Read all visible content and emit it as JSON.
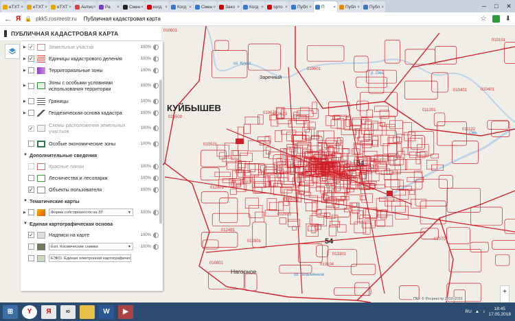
{
  "browser": {
    "tabs": [
      {
        "label": "eTXT",
        "color": "#e4a600"
      },
      {
        "label": "eTXT",
        "color": "#e4a600"
      },
      {
        "label": "eTXT",
        "color": "#e4a600"
      },
      {
        "label": "Антис",
        "color": "#e04040"
      },
      {
        "label": "Ра",
        "color": "#7a3fbf"
      },
      {
        "label": "Смен",
        "color": "#222222"
      },
      {
        "label": "когд",
        "color": "#d00000"
      },
      {
        "label": "Когд",
        "color": "#3a78c9"
      },
      {
        "label": "Смен",
        "color": "#3a78c9"
      },
      {
        "label": "Зако",
        "color": "#d00000"
      },
      {
        "label": "Когд",
        "color": "#3a78c9"
      },
      {
        "label": "орто",
        "color": "#d00000"
      },
      {
        "label": "Публ",
        "color": "#3a78c9"
      },
      {
        "label": "П",
        "color": "#3a78c9"
      },
      {
        "label": "Публ",
        "color": "#e08a00"
      },
      {
        "label": "Публ",
        "color": "#3a78c9"
      }
    ],
    "active_tab": 13,
    "url": "pkk5.rosreestr.ru",
    "page_title": "Публичная кадастровая карта",
    "brand": "Я"
  },
  "app": {
    "title": "ПУБЛИЧНАЯ КАДАСТРОВАЯ КАРТА"
  },
  "layers": {
    "rows": [
      {
        "name": "Земельные участки",
        "pct": "100%",
        "checked": true,
        "disabled": true,
        "arrow": "▶",
        "icon": "parcel"
      },
      {
        "name": "Единицы кадастрового деления",
        "pct": "100%",
        "checked": true,
        "disabled": false,
        "arrow": "▶",
        "icon": "redlines"
      },
      {
        "name": "Территориальные зоны",
        "pct": "100%",
        "checked": false,
        "disabled": false,
        "arrow": "▶",
        "icon": "purple"
      },
      {
        "name": "Зоны с особыми условиями использования территории",
        "pct": "100%",
        "checked": false,
        "disabled": false,
        "arrow": "▶",
        "icon": "green",
        "tall": true
      },
      {
        "name": "Границы",
        "pct": "100%",
        "checked": false,
        "disabled": false,
        "arrow": "▶",
        "icon": "borders"
      },
      {
        "name": "Геодезическая основа кадастра",
        "pct": "100%",
        "checked": false,
        "disabled": false,
        "arrow": "▶",
        "icon": "triangle"
      },
      {
        "name": "Схемы расположения земельных участков",
        "pct": "100%",
        "checked": true,
        "disabled": true,
        "arrow": "",
        "icon": "scheme",
        "tall": true
      },
      {
        "name": "Особые экономические зоны",
        "pct": "100%",
        "checked": false,
        "disabled": false,
        "arrow": "",
        "icon": "oez"
      }
    ],
    "extra_section": "Дополнительные сведения",
    "extra_rows": [
      {
        "name": "Красные линии",
        "pct": "100%",
        "checked": false,
        "disabled": true,
        "icon": "redline"
      },
      {
        "name": "Лесничества и лесопарки",
        "pct": "100%",
        "checked": false,
        "disabled": false,
        "icon": "forest"
      },
      {
        "name": "Объекты пользователя",
        "pct": "100%",
        "checked": true,
        "disabled": false,
        "icon": "user"
      }
    ],
    "thematic_section": "Тематические карты",
    "thematic_row": {
      "select": "Форма собственности на ЗУ",
      "pct": "100%"
    },
    "basemap_section": "Единая картографическая основа",
    "basemap_rows": [
      {
        "name": "Надписи на карте",
        "pct": "100%",
        "checked": true
      },
      {
        "select": "Esri. Космические снимки",
        "pct": "100%"
      },
      {
        "select": "ЕЭКО. Единая электронная картографичес"
      }
    ]
  },
  "map": {
    "city": "КУЙБЫШЕВ",
    "city_code": "025509",
    "place_zarechny": "Заречный",
    "place_nagornoe": "Нагорное",
    "label_54": "54",
    "label_54b": "54",
    "labels": [
      "010601",
      "010101",
      "010401",
      "010401",
      "011201",
      "011122",
      "010623",
      "010521",
      "010623",
      "011317",
      "012431",
      "011901",
      "012871",
      "012910",
      "010702",
      "012801",
      "013104",
      "010601",
      "013301",
      "010801",
      "012481",
      "012906"
    ],
    "water_labels": [
      "оз. Кругл.",
      "р. Омь",
      "оз. Безымянное",
      "Омь"
    ],
    "credits": "ПКК © Росреестр 2010-2015"
  },
  "taskbar": {
    "lang": "RU",
    "time": "18:45",
    "date": "17.05.2018"
  }
}
